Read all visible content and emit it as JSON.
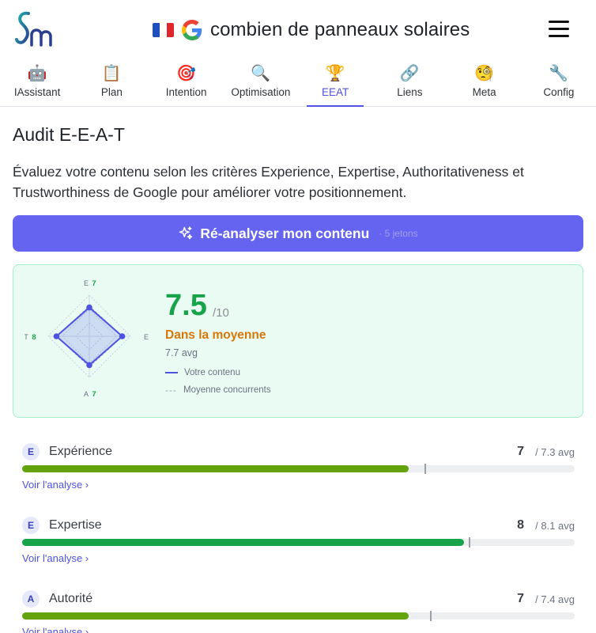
{
  "header": {
    "keyword": "combien de panneaux solaires",
    "flag_colors": [
      "#1f4fbf",
      "#ffffff",
      "#e0262d"
    ],
    "menu_icon": "hamburger-icon"
  },
  "tabs": [
    {
      "label": "IAssistant",
      "icon": "🤖",
      "icon_name": "robot-icon"
    },
    {
      "label": "Plan",
      "icon": "📋",
      "icon_name": "clipboard-icon"
    },
    {
      "label": "Intention",
      "icon": "🎯",
      "icon_name": "target-icon"
    },
    {
      "label": "Optimisation",
      "icon": "🔍",
      "icon_name": "magnifier-icon"
    },
    {
      "label": "EEAT",
      "icon": "🏆",
      "icon_name": "trophy-icon",
      "active": true
    },
    {
      "label": "Liens",
      "icon": "🔗",
      "icon_name": "link-icon"
    },
    {
      "label": "Meta",
      "icon": "🧐",
      "icon_name": "monocle-face-icon"
    },
    {
      "label": "Config",
      "icon": "🔧",
      "icon_name": "wrench-icon"
    }
  ],
  "page": {
    "title": "Audit E-E-A-T",
    "description": "Évaluez votre contenu selon les critères Experience, Expertise, Authoritativeness et Trustworthiness de Google pour améliorer votre positionnement."
  },
  "cta": {
    "label": "Ré-analyser mon contenu",
    "cost": "· 5 jetons",
    "color": "#6464f0"
  },
  "score": {
    "value": "7.5",
    "max": "/10",
    "status": "Dans la moyenne",
    "avg": "7.7 avg",
    "legend_user": "Votre contenu",
    "legend_dash": "---",
    "legend_comp": "Moyenne concurrents",
    "radar": {
      "axes": [
        {
          "letter": "E",
          "value": 7
        },
        {
          "letter": "E",
          "value": 8
        },
        {
          "letter": "A",
          "value": 7
        },
        {
          "letter": "T",
          "value": 8
        }
      ],
      "competitor_values": [
        7.3,
        8.1,
        7.4,
        8.0
      ],
      "max": 10
    }
  },
  "criteria": [
    {
      "letter": "E",
      "name": "Expérience",
      "score": "7",
      "avg": "/ 7.3 avg",
      "score_num": 7,
      "avg_num": 7.3,
      "color": "#65a30d",
      "link": "Voir l'analyse ›"
    },
    {
      "letter": "E",
      "name": "Expertise",
      "score": "8",
      "avg": "/ 8.1 avg",
      "score_num": 8,
      "avg_num": 8.1,
      "color": "#16a34a",
      "link": "Voir l'analyse ›"
    },
    {
      "letter": "A",
      "name": "Autorité",
      "score": "7",
      "avg": "/ 7.4 avg",
      "score_num": 7,
      "avg_num": 7.4,
      "color": "#65a30d",
      "link": "Voir l'analyse ›"
    }
  ]
}
